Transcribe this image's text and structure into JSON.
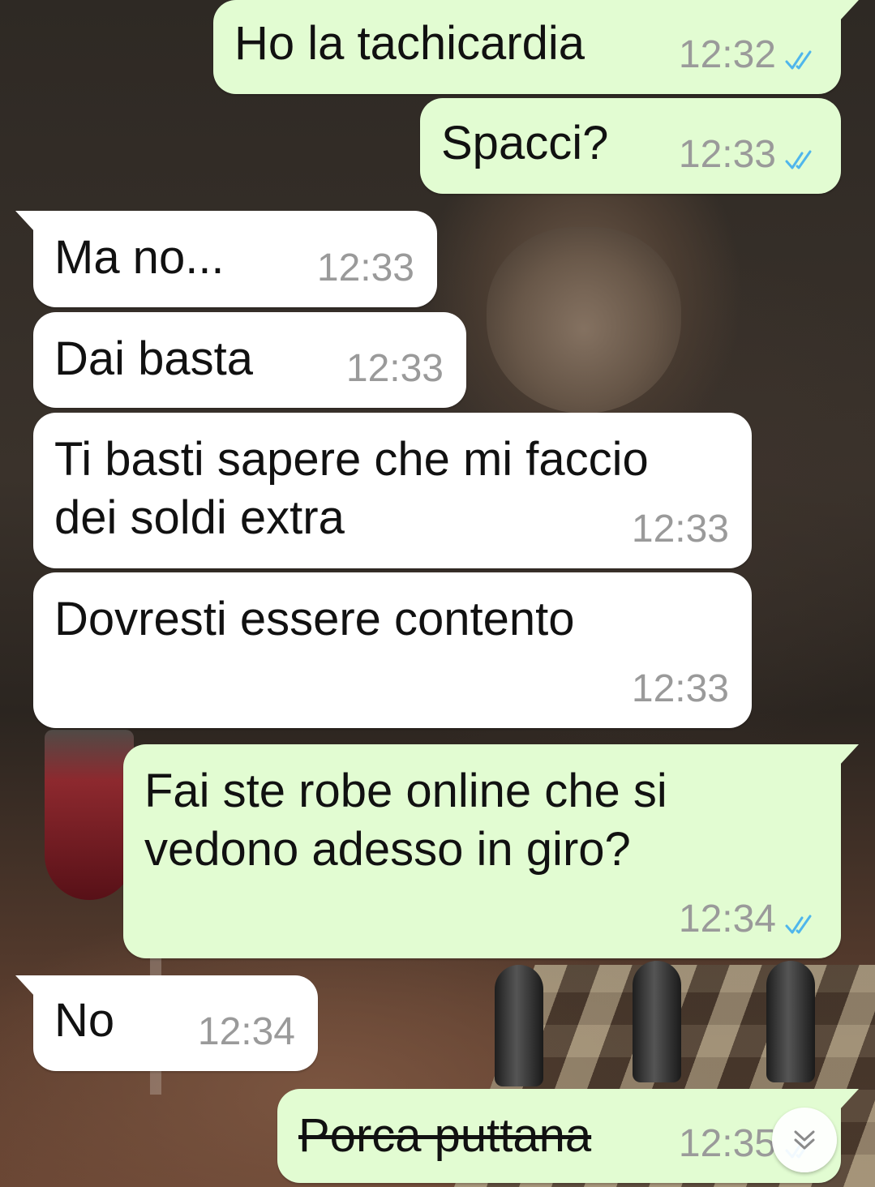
{
  "chat": {
    "messages": [
      {
        "direction": "outgoing",
        "text": "Ho la tachicardia",
        "time": "12:32",
        "status": "read"
      },
      {
        "direction": "outgoing",
        "text": "Spacci?",
        "time": "12:33",
        "status": "read"
      },
      {
        "direction": "incoming",
        "text": "Ma no...",
        "time": "12:33"
      },
      {
        "direction": "incoming",
        "text": "Dai basta",
        "time": "12:33"
      },
      {
        "direction": "incoming",
        "text": "Ti basti sapere che mi faccio\ndei soldi extra",
        "time": "12:33"
      },
      {
        "direction": "incoming",
        "text": "Dovresti essere contento",
        "time": "12:33"
      },
      {
        "direction": "outgoing",
        "text": "Fai ste robe online che si\nvedono adesso in giro?",
        "time": "12:34",
        "status": "read"
      },
      {
        "direction": "incoming",
        "text": "No",
        "time": "12:34"
      },
      {
        "direction": "outgoing",
        "text": "Porca puttana",
        "time": "12:35",
        "status": "read",
        "struck_through": true
      }
    ]
  },
  "colors": {
    "outgoing_bubble": "#e2fcd2",
    "incoming_bubble": "#ffffff",
    "read_ticks": "#4fb6ec",
    "timestamp": "#9a9a9a"
  },
  "icons": {
    "read_receipt": "double-check-icon",
    "scroll_down": "double-chevron-down-icon"
  }
}
